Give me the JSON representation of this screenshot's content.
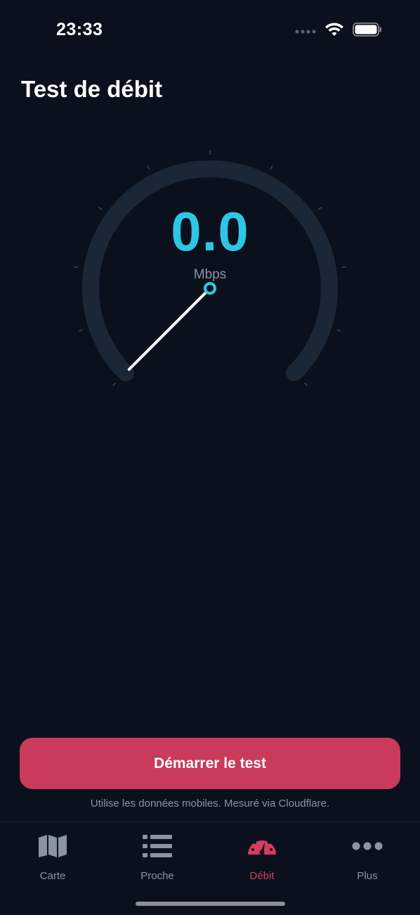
{
  "status_bar": {
    "time": "23:33",
    "icons": [
      "signal-dots-icon",
      "wifi-icon",
      "battery-icon"
    ]
  },
  "page": {
    "title": "Test de débit"
  },
  "gauge": {
    "value": "0.0",
    "unit": "Mbps",
    "min_value": 0,
    "current_value": 0,
    "colors": {
      "track": "#1b2637",
      "value": "#2ec6e4",
      "needle": "#ffffff",
      "ticks": "#3a4556"
    }
  },
  "actions": {
    "start_label": "Démarrer le test",
    "footnote": "Utilise les données mobiles. Mesuré via Cloudflare."
  },
  "tabs": [
    {
      "label": "Carte",
      "icon": "map-icon",
      "active": false
    },
    {
      "label": "Proche",
      "icon": "list-icon",
      "active": false
    },
    {
      "label": "Débit",
      "icon": "speedometer-icon",
      "active": true
    },
    {
      "label": "Plus",
      "icon": "more-dots-icon",
      "active": false
    }
  ],
  "colors": {
    "background": "#0b111c",
    "accent": "#c93a5b",
    "active_tab": "#d63c62",
    "inactive": "#8b94a3"
  }
}
